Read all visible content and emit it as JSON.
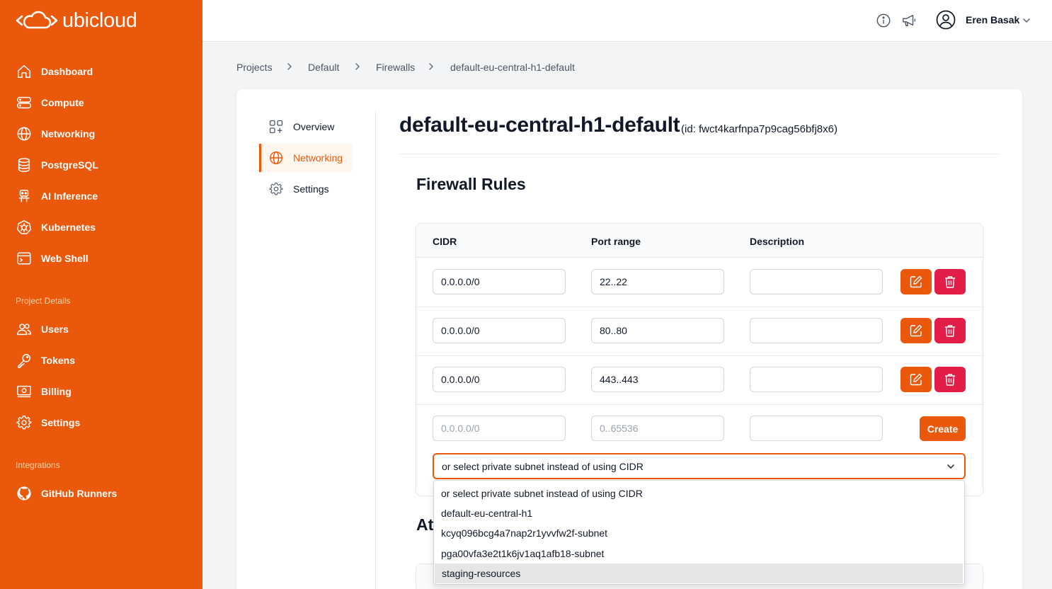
{
  "brand": {
    "name": "ubicloud",
    "accent": "#ea580c",
    "danger": "#e11d48"
  },
  "sidebar": {
    "items": [
      {
        "label": "Dashboard",
        "icon": "home-icon"
      },
      {
        "label": "Compute",
        "icon": "server-icon"
      },
      {
        "label": "Networking",
        "icon": "globe-icon"
      },
      {
        "label": "PostgreSQL",
        "icon": "database-icon"
      },
      {
        "label": "AI Inference",
        "icon": "robot-icon"
      },
      {
        "label": "Kubernetes",
        "icon": "kubernetes-icon"
      },
      {
        "label": "Web Shell",
        "icon": "terminal-icon"
      }
    ],
    "project_section_title": "Project Details",
    "project_items": [
      {
        "label": "Users",
        "icon": "users-icon"
      },
      {
        "label": "Tokens",
        "icon": "key-icon"
      },
      {
        "label": "Billing",
        "icon": "billing-icon"
      },
      {
        "label": "Settings",
        "icon": "gear-icon"
      }
    ],
    "integrations_title": "Integrations",
    "integration_items": [
      {
        "label": "GitHub Runners",
        "icon": "github-icon"
      }
    ]
  },
  "topbar": {
    "user_name": "Eren Basak",
    "icons": [
      "info-icon",
      "megaphone-icon",
      "user-circle-icon",
      "chevron-down-icon"
    ]
  },
  "breadcrumb": [
    "Projects",
    "Default",
    "Firewalls",
    "default-eu-central-h1-default"
  ],
  "subnav": [
    {
      "label": "Overview",
      "icon": "overview-icon",
      "active": false
    },
    {
      "label": "Networking",
      "icon": "globe-icon",
      "active": true
    },
    {
      "label": "Settings",
      "icon": "gear-icon",
      "active": false
    }
  ],
  "page": {
    "title": "default-eu-central-h1-default",
    "id_text": "(id: fwct4karfnpa7p9cag56bfj8x6)",
    "section_title": "Firewall Rules",
    "next_section_partial": "At"
  },
  "table": {
    "headers": [
      "CIDR",
      "Port range",
      "Description"
    ],
    "rows": [
      {
        "cidr": "0.0.0.0/0",
        "port": "22..22",
        "description": ""
      },
      {
        "cidr": "0.0.0.0/0",
        "port": "80..80",
        "description": ""
      },
      {
        "cidr": "0.0.0.0/0",
        "port": "443..443",
        "description": ""
      }
    ],
    "new_row": {
      "cidr_placeholder": "0.0.0.0/0",
      "port_placeholder": "0..65536",
      "description": ""
    },
    "create_label": "Create"
  },
  "subnet_select": {
    "selected": "or select private subnet instead of using CIDR",
    "options": [
      "or select private subnet instead of using CIDR",
      "default-eu-central-h1",
      "kcyq096bcg4a7nap2r1yvvfw2f-subnet",
      "pga00vfa3e2t1k6jv1aq1afb18-subnet",
      "staging-resources"
    ],
    "highlighted_index": 4
  }
}
